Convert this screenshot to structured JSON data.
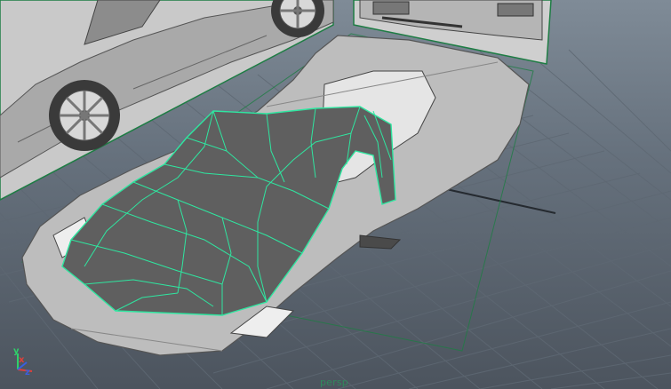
{
  "viewport": {
    "camera_label": "persp",
    "axis": {
      "x": "x",
      "y": "y",
      "z": "z"
    }
  },
  "colors": {
    "grid": "#5e6873",
    "grid_major": "#1b1f24",
    "wireframe": "#2fe6a0",
    "mesh": "#5f5f5f",
    "plane_border": "#1e7d44",
    "axis_x": "#e0403a",
    "axis_y": "#2fd06a",
    "axis_z": "#3a5fe0"
  }
}
